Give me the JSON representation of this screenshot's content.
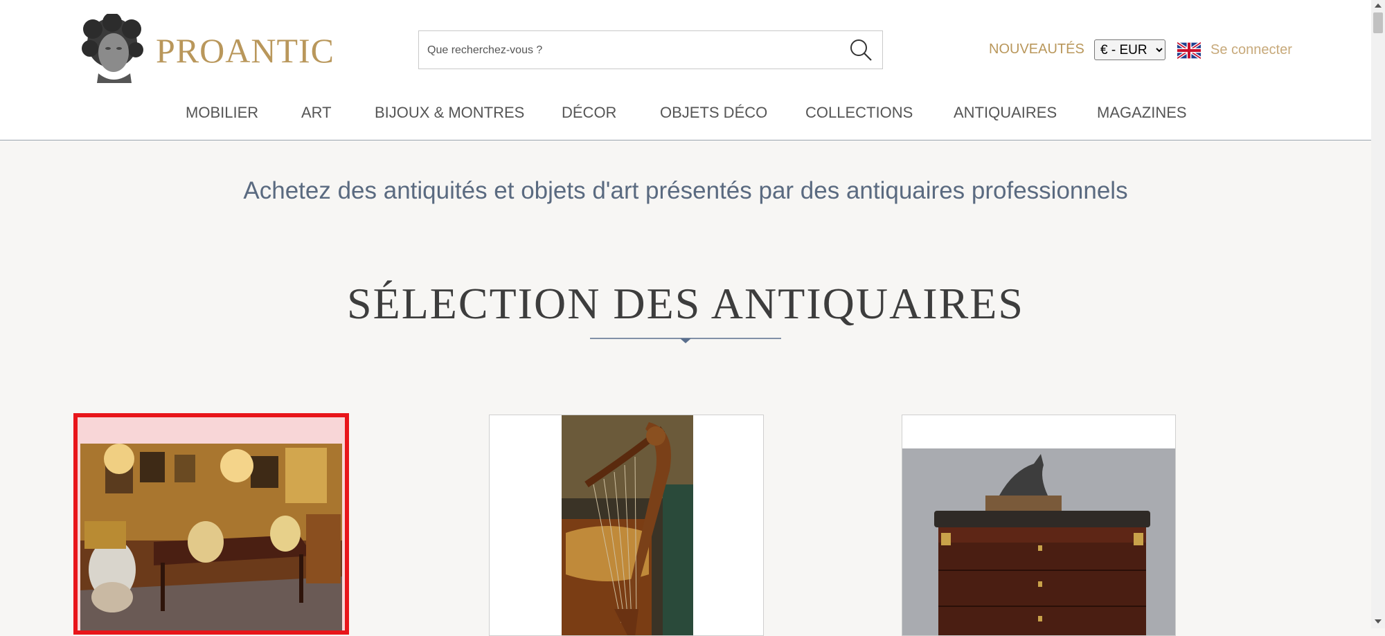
{
  "header": {
    "brand": "PROANTIC",
    "search": {
      "placeholder": "Que recherchez-vous ?"
    },
    "new_link": "NOUVEAUTÉS",
    "currency": {
      "selected": "€ - EUR"
    },
    "login": "Se connecter"
  },
  "nav": {
    "items": [
      "MOBILIER",
      "ART",
      "BIJOUX & MONTRES",
      "DÉCOR",
      "OBJETS DÉCO",
      "COLLECTIONS",
      "ANTIQUAIRES",
      "MAGAZINES"
    ]
  },
  "main": {
    "tagline": "Achetez des antiquités et objets d'art présentés par des antiquaires professionnels",
    "section_title": "SÉLECTION DES ANTIQUAIRES"
  },
  "colors": {
    "accent_gold": "#b9975b",
    "selection_red": "#e8151a",
    "divider_blue": "#5a6f8d"
  }
}
